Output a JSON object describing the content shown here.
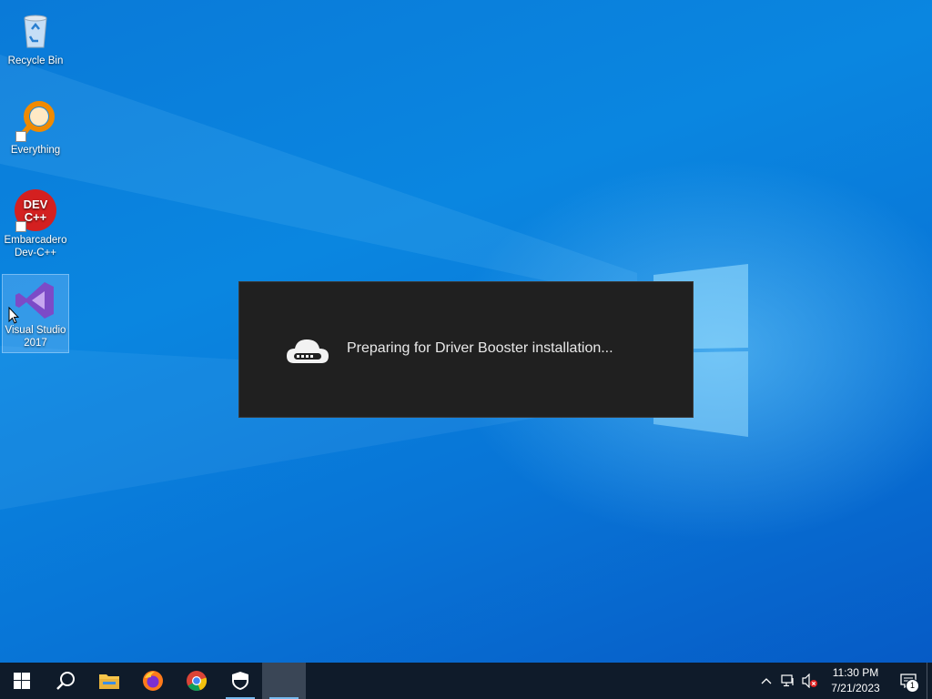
{
  "desktop": {
    "icons": [
      {
        "label": "Recycle Bin",
        "icon": "recycle-bin-icon"
      },
      {
        "label": "Everything",
        "icon": "everything-search-icon"
      },
      {
        "label": "Embarcadero Dev-C++",
        "icon": "dev-cpp-icon",
        "icon_text": "DEV C++"
      },
      {
        "label": "Visual Studio 2017",
        "icon": "visual-studio-icon"
      }
    ]
  },
  "dialog": {
    "message": "Preparing for Driver Booster installation...",
    "icon": "cloud-progress-icon"
  },
  "taskbar": {
    "apps": [
      "start-icon",
      "search-icon",
      "file-explorer-icon",
      "firefox-icon",
      "chrome-icon",
      "security-shield-icon",
      "driver-booster-app"
    ],
    "tray": {
      "icons": [
        "chevron-up-icon",
        "network-icon",
        "volume-muted-icon"
      ],
      "time": "11:30 PM",
      "date": "7/21/2023",
      "notification_count": "1"
    }
  },
  "colors": {
    "desktop_blue": "#0a7ad8",
    "dialog_bg": "#202020",
    "taskbar_bg": "#0f1b2a"
  }
}
